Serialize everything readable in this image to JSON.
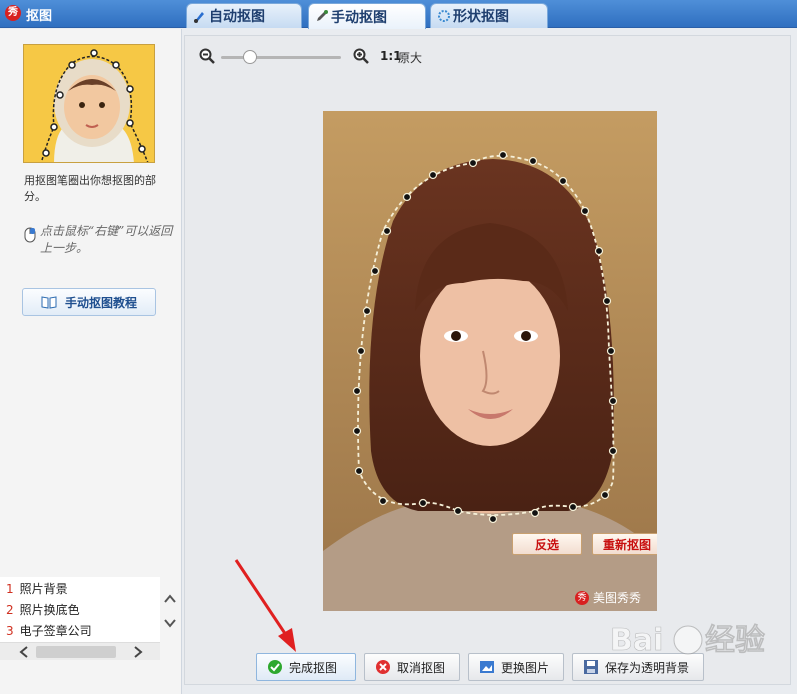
{
  "app": {
    "title": "抠图",
    "logo_text": "秀"
  },
  "tabs": [
    {
      "label": "自动抠图",
      "active": false,
      "icon": "brush-icon"
    },
    {
      "label": "手动抠图",
      "active": true,
      "icon": "pen-icon"
    },
    {
      "label": "形状抠图",
      "active": false,
      "icon": "shape-icon"
    }
  ],
  "sidebar": {
    "hint_text": "用抠图笔圈出你想抠图的部分。",
    "mouse_hint": "点击鼠标“右键”可以返回上一步。",
    "tutorial_label": "手动抠图教程",
    "ads": [
      {
        "num": "1",
        "label": "照片背景"
      },
      {
        "num": "2",
        "label": "照片换底色"
      },
      {
        "num": "3",
        "label": "电子签章公司"
      }
    ]
  },
  "zoom": {
    "ratio": "1:1",
    "original_label": "原大",
    "level": 0.25
  },
  "photo": {
    "invert_label": "反选",
    "reselect_label": "重新抠图",
    "watermark": "美图秀秀",
    "watermark_logo": "秀"
  },
  "bottom": {
    "done_label": "完成抠图",
    "cancel_label": "取消抠图",
    "change_label": "更换图片",
    "save_label": "保存为透明背景"
  },
  "colors": {
    "accent": "#2f6fc0",
    "danger": "#c81010",
    "arrow": "#e02020"
  },
  "watermark_site": {
    "text": "经验",
    "brand": "Bai du"
  }
}
